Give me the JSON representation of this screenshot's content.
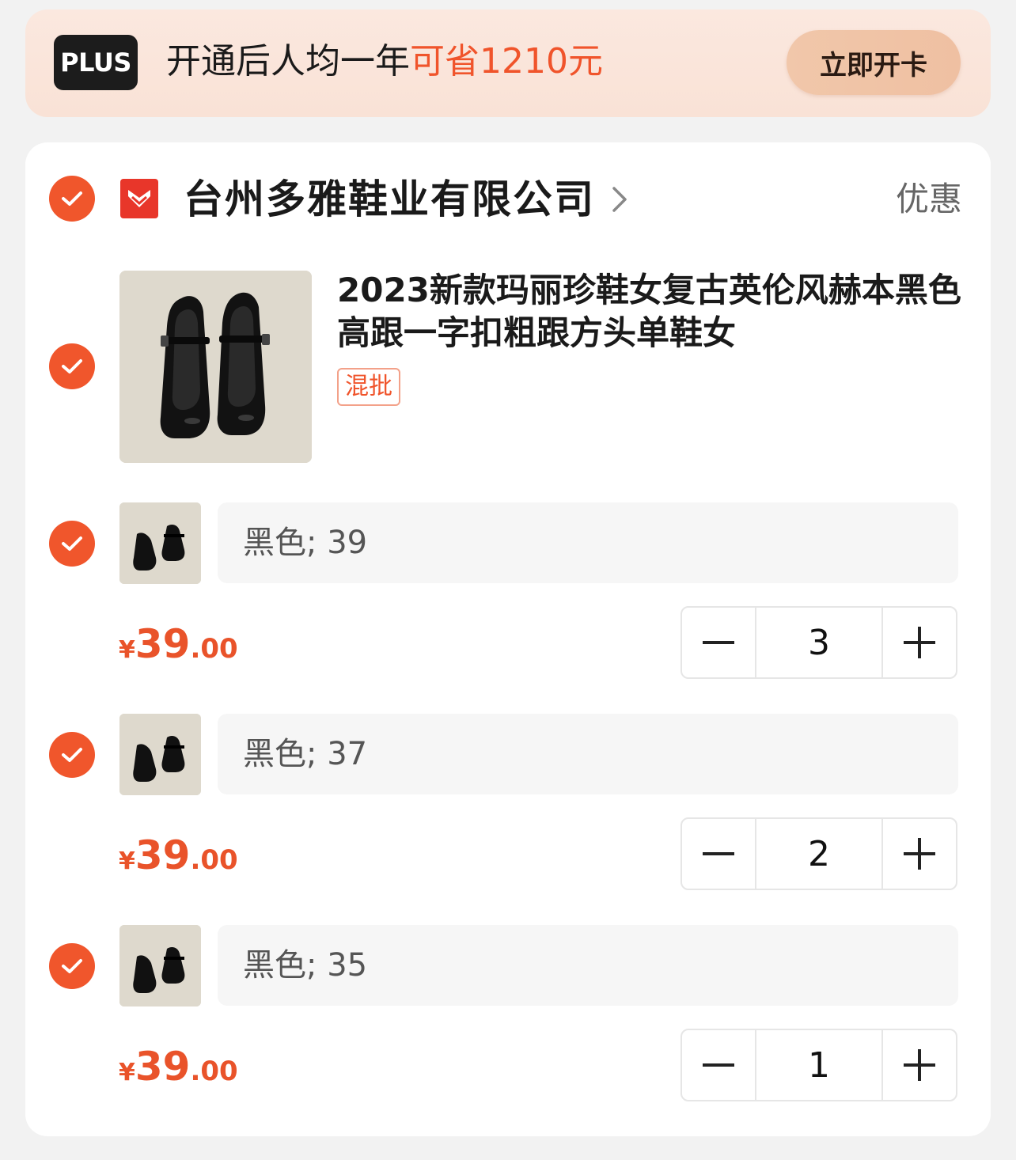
{
  "plus_banner": {
    "logo_text": "PLUS",
    "text_prefix": "开通后人均一年",
    "text_highlight": "可省1210元",
    "button_label": "立即开卡"
  },
  "shop": {
    "name": "台州多雅鞋业有限公司",
    "discount_label": "优惠",
    "logo_icon": "shop-logo-icon"
  },
  "product": {
    "title": "2023新款玛丽珍鞋女复古英伦风赫本黑色高跟一字扣粗跟方头单鞋女",
    "tag": "混批"
  },
  "skus": [
    {
      "spec": "黑色; 39",
      "currency": "¥",
      "price_int": "39",
      "price_dec": ".00",
      "qty": "3"
    },
    {
      "spec": "黑色; 37",
      "currency": "¥",
      "price_int": "39",
      "price_dec": ".00",
      "qty": "2"
    },
    {
      "spec": "黑色; 35",
      "currency": "¥",
      "price_int": "39",
      "price_dec": ".00",
      "qty": "1"
    }
  ],
  "colors": {
    "accent": "#f0562c",
    "price": "#e9532a",
    "banner_bg": "#fbe8df",
    "button_bg": "#f1c7aa"
  }
}
